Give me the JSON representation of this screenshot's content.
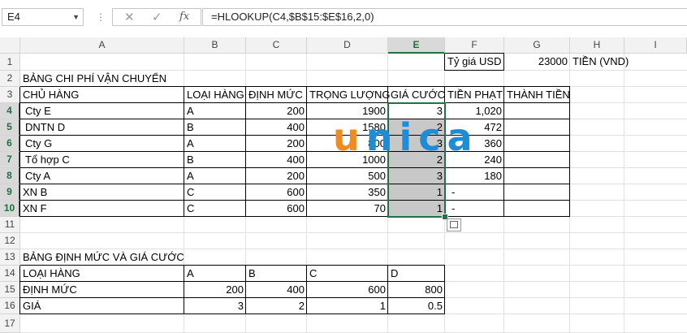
{
  "formula_bar": {
    "name_box": "E4",
    "fx": "fx",
    "cancel": "✕",
    "enter": "✓",
    "formula": "=HLOOKUP(C4,$B$15:$E$16,2,0)"
  },
  "columns": [
    "A",
    "B",
    "C",
    "D",
    "E",
    "F",
    "G",
    "H",
    "I"
  ],
  "selected_column": "E",
  "rows": [
    "1",
    "2",
    "3",
    "4",
    "5",
    "6",
    "7",
    "8",
    "9",
    "10",
    "11",
    "12",
    "13",
    "14",
    "15",
    "16",
    "17"
  ],
  "selected_rows": [
    "4",
    "5",
    "6",
    "7",
    "8",
    "9",
    "10"
  ],
  "logo": {
    "u": "u",
    "rest": "nica"
  },
  "cells": {
    "F1": "Tỷ giá USD",
    "G1": "23000",
    "H1": "TIỀN (VND)",
    "A2": "BẢNG CHI PHÍ VẬN CHUYỂN",
    "A3": "CHỦ HÀNG",
    "B3": "LOẠI HÀNG",
    "C3": "ĐỊNH MỨC",
    "D3": "TRỌNG LƯỢNG",
    "E3": "GIÁ CƯỚC",
    "F3": "TIỀN PHẠT",
    "G3": "THÀNH TIỀN",
    "A4": "Cty E",
    "B4": "A",
    "C4": "200",
    "D4": "1900",
    "E4": "3",
    "F4": "1,020",
    "A5": "DNTN D",
    "B5": "B",
    "C5": "400",
    "D5": "1580",
    "E5": "2",
    "F5": "472",
    "A6": "Cty G",
    "B6": "A",
    "C6": "200",
    "D6": "800",
    "E6": "3",
    "F6": "360",
    "A7": "Tổ hợp C",
    "B7": "B",
    "C7": "400",
    "D7": "1000",
    "E7": "2",
    "F7": "240",
    "A8": "Cty A",
    "B8": "A",
    "C8": "200",
    "D8": "500",
    "E8": "3",
    "F8": "180",
    "A9": "XN B",
    "B9": "C",
    "C9": "600",
    "D9": "350",
    "E9": "1",
    "F9": "-",
    "A10": "XN F",
    "B10": "C",
    "C10": "600",
    "D10": "70",
    "E10": "1",
    "F10": "-",
    "A13": "BẢNG ĐỊNH MỨC VÀ GIÁ CƯỚC",
    "A14": "LOẠI HÀNG",
    "B14": "A",
    "C14": "B",
    "D14": "C",
    "E14": "D",
    "A15": "ĐỊNH MỨC",
    "B15": "200",
    "C15": "400",
    "D15": "600",
    "E15": "800",
    "A16": "GIÁ",
    "B16": "3",
    "C16": "2",
    "D16": "1",
    "E16": "0.5"
  }
}
